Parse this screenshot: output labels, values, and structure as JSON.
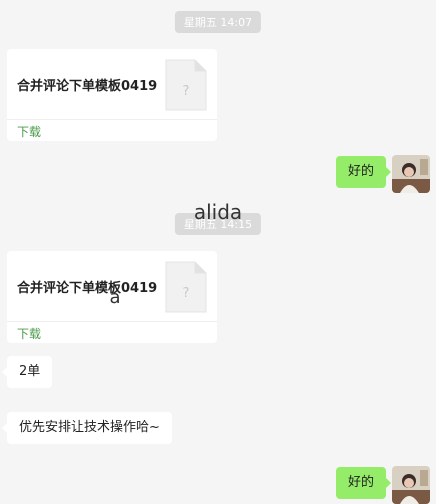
{
  "chat": {
    "timestamp_1": "星期五 14:07",
    "timestamp_2": "星期五 14:15",
    "overlay_name": "alida",
    "overlay_char": "a",
    "file_1": {
      "title": "合并评论下单模板0419",
      "download": "下载",
      "icon": "unknown-file-icon"
    },
    "file_2": {
      "title": "合并评论下单模板0419",
      "download": "下载",
      "icon": "unknown-file-icon"
    },
    "messages": [
      {
        "side": "out",
        "text": "好的"
      },
      {
        "side": "in",
        "text": "2单"
      },
      {
        "side": "in",
        "text": "优先安排让技术操作哈~"
      },
      {
        "side": "out",
        "text": "好的"
      }
    ]
  },
  "colors": {
    "background": "#f5f5f5",
    "outgoing_bubble": "#95ec69",
    "incoming_bubble": "#ffffff",
    "download_text": "#4c9a4c"
  }
}
